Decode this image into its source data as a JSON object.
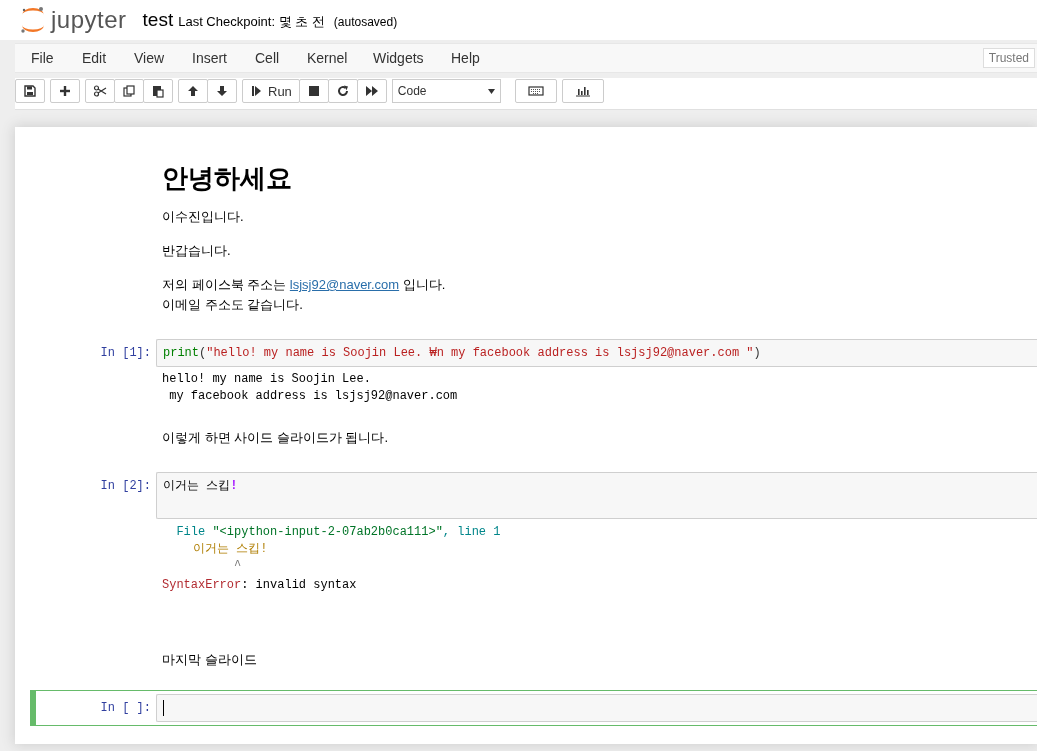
{
  "header": {
    "logo_text": "jupyter",
    "notebook_name": "test",
    "checkpoint": "Last Checkpoint: 몇 초 전",
    "autosave": "(autosaved)"
  },
  "menu": [
    "File",
    "Edit",
    "View",
    "Insert",
    "Cell",
    "Kernel",
    "Widgets",
    "Help"
  ],
  "trusted": "Trusted",
  "toolbar": {
    "run_label": "Run",
    "cell_type": "Code"
  },
  "cells": [
    {
      "kind": "markdown",
      "selected": false,
      "blocks": [
        {
          "kind": "heading",
          "text": "안녕하세요"
        },
        {
          "kind": "paragraph",
          "lines": [
            [
              {
                "kind": "text",
                "text": "이수진입니다."
              }
            ]
          ]
        },
        {
          "kind": "paragraph",
          "lines": [
            [
              {
                "kind": "text",
                "text": "반갑습니다."
              }
            ]
          ]
        },
        {
          "kind": "paragraph",
          "lines": [
            [
              {
                "kind": "text",
                "text": "저의 페이스북 주소는 "
              },
              {
                "kind": "link",
                "text": "lsjsj92@naver.com"
              },
              {
                "kind": "text",
                "text": " 입니다."
              }
            ],
            [
              {
                "kind": "text",
                "text": "이메일 주소도 같습니다."
              }
            ]
          ]
        }
      ]
    },
    {
      "kind": "code",
      "selected": false,
      "prompt": "In [1]:",
      "lines": [
        [
          {
            "kind": "builtin",
            "text": "print"
          },
          {
            "kind": "punct",
            "text": "("
          },
          {
            "kind": "string",
            "text": "\"hello! my name is Soojin Lee. ₩n my facebook address is lsjsj92@naver.com \""
          },
          {
            "kind": "punct",
            "text": ")"
          }
        ]
      ],
      "output": {
        "kind": "stream",
        "lines": [
          "hello! my name is Soojin Lee.",
          " my facebook address is lsjsj92@naver.com"
        ]
      }
    },
    {
      "kind": "markdown",
      "selected": false,
      "blocks": [
        {
          "kind": "paragraph",
          "lines": [
            [
              {
                "kind": "text",
                "text": "이렇게 하면 사이드 슬라이드가 됩니다."
              }
            ]
          ]
        }
      ]
    },
    {
      "kind": "code",
      "selected": false,
      "prompt": "In [2]:",
      "lines": [
        [
          {
            "kind": "plain",
            "text": "이거는 스킵"
          },
          {
            "kind": "operator",
            "text": "!"
          }
        ]
      ],
      "output": {
        "kind": "error",
        "file_label": "File",
        "file_path": "\"<ipython-input-2-07ab2b0ca111>\"",
        "file_line": ", line 1",
        "source": "이거는 스킵!",
        "caret": "^",
        "ename": "SyntaxError",
        "evalue": ": invalid syntax"
      }
    },
    {
      "kind": "markdown",
      "selected": false,
      "blocks": [
        {
          "kind": "paragraph",
          "lines": [
            [
              {
                "kind": "text",
                "text": "마지막 슬라이드"
              }
            ]
          ]
        }
      ]
    },
    {
      "kind": "code",
      "selected": true,
      "prompt": "In [ ]:"
    }
  ]
}
